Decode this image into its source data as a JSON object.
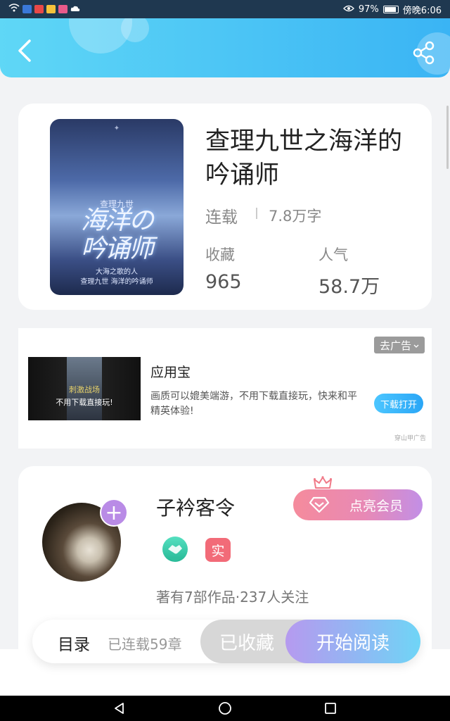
{
  "status_bar": {
    "battery": "97%",
    "time": "傍晚6:06"
  },
  "book": {
    "cover": {
      "top": "查理九世",
      "title_line1": "海洋の",
      "title_line2": "吟诵师",
      "small1": "大海之歌的人",
      "small2": "查理九世 海洋的吟诵师"
    },
    "title": "查理九世之海洋的吟诵师",
    "status": "连载",
    "words": "7.8万字",
    "collect_label": "收藏",
    "collect_value": "965",
    "popularity_label": "人气",
    "popularity_value": "58.7万"
  },
  "ad": {
    "close_label": "去广告",
    "title": "应用宝",
    "description": "画质可以媲美端游，不用下载直接玩，快来和平精英体验!",
    "button": "下载打开",
    "source": "穿山甲广告",
    "image_text1": "刺激战场",
    "image_text2": "不用下载直接玩!"
  },
  "author": {
    "name": "子衿客令",
    "vip_label": "点亮会员",
    "badge_real": "实",
    "meta": "著有7部作品·237人关注"
  },
  "actions": {
    "toc": "目录",
    "chapters": "已连载59章",
    "collected": "已收藏",
    "read": "开始阅读"
  },
  "colors": {
    "header_start": "#5fd7f6",
    "header_end": "#3ab4f4",
    "vip_start": "#f58b9c",
    "vip_end": "#c28fe6",
    "read_start": "#b69aef",
    "read_end": "#6fd5f6"
  },
  "icons": [
    "back-icon",
    "share-icon",
    "crown-icon",
    "diamond-icon",
    "handshake-icon",
    "plus-icon"
  ]
}
